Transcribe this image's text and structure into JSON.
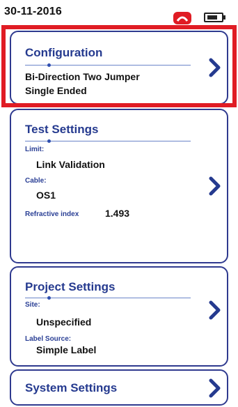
{
  "status_bar": {
    "date": "30-11-2016"
  },
  "configuration": {
    "title": "Configuration",
    "line1": "Bi-Direction Two Jumper",
    "line2": "Single Ended"
  },
  "test_settings": {
    "title": "Test Settings",
    "limit_label": "Limit:",
    "limit_value": "Link Validation",
    "cable_label": "Cable:",
    "cable_value": "OS1",
    "refractive_label": "Refractive index",
    "refractive_value": "1.493"
  },
  "project_settings": {
    "title": "Project Settings",
    "site_label": "Site:",
    "site_value": "Unspecified",
    "label_source_label": "Label Source:",
    "label_source_value": "Simple Label"
  },
  "system_settings": {
    "title": "System Settings"
  },
  "icons": [
    "red-phone-icon",
    "battery-icon",
    "chevron-right-icon"
  ],
  "colors": {
    "accent": "#253a8f",
    "highlight": "#e01c24"
  }
}
